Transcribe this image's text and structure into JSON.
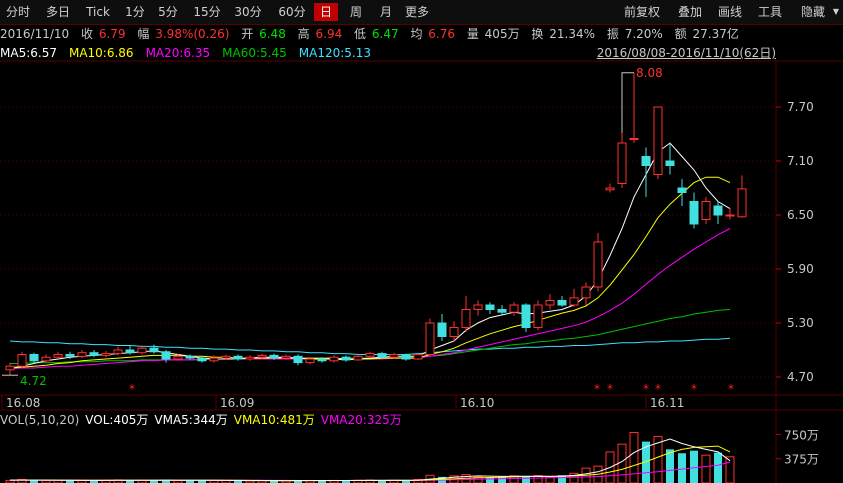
{
  "toolbar": {
    "periods": [
      "分时",
      "多日",
      "Tick",
      "1分",
      "5分",
      "15分",
      "30分",
      "60分",
      "日",
      "周",
      "月",
      "更多"
    ],
    "active_period": "日",
    "tools": [
      "前复权",
      "叠加",
      "画线",
      "工具",
      "隐藏"
    ]
  },
  "info": {
    "date": "2016/11/10",
    "close_label": "收",
    "close": "6.79",
    "change_label": "幅",
    "change": "3.98%(0.26)",
    "open_label": "开",
    "open": "6.48",
    "high_label": "高",
    "high": "6.94",
    "low_label": "低",
    "low": "6.47",
    "avg_label": "均",
    "avg": "6.76",
    "volume_label": "量",
    "volume": "405万",
    "turnover_label": "换",
    "turnover": "21.34%",
    "amplitude_label": "振",
    "amplitude": "7.20%",
    "amount_label": "额",
    "amount": "27.37亿"
  },
  "ma_legend": [
    {
      "text": "MA5:6.57",
      "color": "#ffffff"
    },
    {
      "text": "MA10:6.86",
      "color": "#ffff00"
    },
    {
      "text": "MA20:6.35",
      "color": "#ff00ff"
    },
    {
      "text": "MA60:5.45",
      "color": "#00c000"
    },
    {
      "text": "MA120:5.13",
      "color": "#40e0ff"
    }
  ],
  "range_label": "2016/08/08-2016/11/10(62日)",
  "price_axis": {
    "ticks": [
      "7.70",
      "7.10",
      "6.50",
      "5.90",
      "5.30",
      "4.70"
    ],
    "annotations": {
      "high": "8.08",
      "low": "4.72"
    }
  },
  "date_axis": [
    "16.08",
    "16.09",
    "16.10",
    "16.11"
  ],
  "volume_legend": [
    {
      "text": "VOL(5,10,20)",
      "color": "#c8c8c8"
    },
    {
      "text": "VOL:405万",
      "color": "#ffffff"
    },
    {
      "text": "VMA5:344万",
      "color": "#ffffff"
    },
    {
      "text": "VMA10:481万",
      "color": "#ffff00"
    },
    {
      "text": "VMA20:325万",
      "color": "#ff00ff"
    }
  ],
  "volume_axis": [
    "750万",
    "375万"
  ],
  "colors": {
    "up": "#ff3030",
    "down": "#40e0e0",
    "grid": "#5a0000",
    "ma5": "#ffffff",
    "ma10": "#ffff00",
    "ma20": "#ff00ff",
    "ma60": "#00c000",
    "ma120": "#40e0ff",
    "star": "#ff2020"
  },
  "chart_data": {
    "type": "candlestick",
    "title": "",
    "ylim": [
      4.5,
      8.2
    ],
    "candles": [
      {
        "o": 4.78,
        "c": 4.82,
        "h": 4.86,
        "l": 4.72
      },
      {
        "o": 4.82,
        "c": 4.95,
        "h": 4.98,
        "l": 4.8
      },
      {
        "o": 4.95,
        "c": 4.88,
        "h": 4.97,
        "l": 4.85
      },
      {
        "o": 4.88,
        "c": 4.92,
        "h": 4.95,
        "l": 4.86
      },
      {
        "o": 4.92,
        "c": 4.95,
        "h": 4.98,
        "l": 4.9
      },
      {
        "o": 4.95,
        "c": 4.93,
        "h": 4.98,
        "l": 4.9
      },
      {
        "o": 4.93,
        "c": 4.97,
        "h": 5.0,
        "l": 4.91
      },
      {
        "o": 4.97,
        "c": 4.94,
        "h": 5.0,
        "l": 4.92
      },
      {
        "o": 4.94,
        "c": 4.96,
        "h": 4.99,
        "l": 4.92
      },
      {
        "o": 4.96,
        "c": 5.0,
        "h": 5.04,
        "l": 4.94
      },
      {
        "o": 5.0,
        "c": 4.97,
        "h": 5.05,
        "l": 4.95
      },
      {
        "o": 4.97,
        "c": 5.02,
        "h": 5.05,
        "l": 4.95
      },
      {
        "o": 5.02,
        "c": 4.98,
        "h": 5.06,
        "l": 4.96
      },
      {
        "o": 4.98,
        "c": 4.9,
        "h": 5.0,
        "l": 4.86
      },
      {
        "o": 4.9,
        "c": 4.93,
        "h": 4.96,
        "l": 4.88
      },
      {
        "o": 4.93,
        "c": 4.91,
        "h": 4.95,
        "l": 4.89
      },
      {
        "o": 4.91,
        "c": 4.88,
        "h": 4.93,
        "l": 4.86
      },
      {
        "o": 4.88,
        "c": 4.91,
        "h": 4.94,
        "l": 4.86
      },
      {
        "o": 4.91,
        "c": 4.93,
        "h": 4.95,
        "l": 4.89
      },
      {
        "o": 4.93,
        "c": 4.9,
        "h": 4.95,
        "l": 4.88
      },
      {
        "o": 4.9,
        "c": 4.92,
        "h": 4.94,
        "l": 4.88
      },
      {
        "o": 4.92,
        "c": 4.94,
        "h": 4.96,
        "l": 4.9
      },
      {
        "o": 4.94,
        "c": 4.91,
        "h": 4.96,
        "l": 4.89
      },
      {
        "o": 4.91,
        "c": 4.93,
        "h": 4.95,
        "l": 4.89
      },
      {
        "o": 4.93,
        "c": 4.86,
        "h": 4.95,
        "l": 4.83
      },
      {
        "o": 4.86,
        "c": 4.9,
        "h": 4.92,
        "l": 4.84
      },
      {
        "o": 4.9,
        "c": 4.88,
        "h": 4.92,
        "l": 4.86
      },
      {
        "o": 4.88,
        "c": 4.92,
        "h": 4.94,
        "l": 4.86
      },
      {
        "o": 4.92,
        "c": 4.89,
        "h": 4.94,
        "l": 4.87
      },
      {
        "o": 4.89,
        "c": 4.93,
        "h": 4.96,
        "l": 4.88
      },
      {
        "o": 4.93,
        "c": 4.96,
        "h": 4.98,
        "l": 4.91
      },
      {
        "o": 4.96,
        "c": 4.92,
        "h": 4.98,
        "l": 4.9
      },
      {
        "o": 4.92,
        "c": 4.95,
        "h": 4.97,
        "l": 4.9
      },
      {
        "o": 4.95,
        "c": 4.9,
        "h": 4.96,
        "l": 4.88
      },
      {
        "o": 4.9,
        "c": 4.95,
        "h": 4.97,
        "l": 4.89
      },
      {
        "o": 4.95,
        "c": 5.3,
        "h": 5.35,
        "l": 4.94
      },
      {
        "o": 5.3,
        "c": 5.15,
        "h": 5.4,
        "l": 5.1
      },
      {
        "o": 5.15,
        "c": 5.25,
        "h": 5.32,
        "l": 5.1
      },
      {
        "o": 5.25,
        "c": 5.45,
        "h": 5.6,
        "l": 5.2
      },
      {
        "o": 5.45,
        "c": 5.5,
        "h": 5.55,
        "l": 5.38
      },
      {
        "o": 5.5,
        "c": 5.45,
        "h": 5.53,
        "l": 5.4
      },
      {
        "o": 5.45,
        "c": 5.42,
        "h": 5.5,
        "l": 5.38
      },
      {
        "o": 5.42,
        "c": 5.5,
        "h": 5.53,
        "l": 5.38
      },
      {
        "o": 5.5,
        "c": 5.25,
        "h": 5.52,
        "l": 5.2
      },
      {
        "o": 5.25,
        "c": 5.5,
        "h": 5.55,
        "l": 5.22
      },
      {
        "o": 5.5,
        "c": 5.55,
        "h": 5.62,
        "l": 5.45
      },
      {
        "o": 5.55,
        "c": 5.5,
        "h": 5.6,
        "l": 5.48
      },
      {
        "o": 5.5,
        "c": 5.58,
        "h": 5.68,
        "l": 5.48
      },
      {
        "o": 5.58,
        "c": 5.7,
        "h": 5.75,
        "l": 5.5
      },
      {
        "o": 5.7,
        "c": 6.2,
        "h": 6.3,
        "l": 5.65
      },
      {
        "o": 6.78,
        "c": 6.8,
        "h": 6.85,
        "l": 6.75
      },
      {
        "o": 6.85,
        "c": 7.3,
        "h": 7.45,
        "l": 6.8
      },
      {
        "o": 7.35,
        "c": 7.35,
        "h": 8.08,
        "l": 7.3
      },
      {
        "o": 7.15,
        "c": 7.05,
        "h": 7.25,
        "l": 6.7
      },
      {
        "o": 6.95,
        "c": 7.7,
        "h": 7.7,
        "l": 6.9
      },
      {
        "o": 7.1,
        "c": 7.05,
        "h": 7.3,
        "l": 6.95
      },
      {
        "o": 6.8,
        "c": 6.75,
        "h": 6.9,
        "l": 6.6
      },
      {
        "o": 6.65,
        "c": 6.4,
        "h": 6.75,
        "l": 6.35
      },
      {
        "o": 6.45,
        "c": 6.65,
        "h": 6.7,
        "l": 6.4
      },
      {
        "o": 6.6,
        "c": 6.5,
        "h": 6.65,
        "l": 6.4
      },
      {
        "o": 6.5,
        "c": 6.5,
        "h": 6.58,
        "l": 6.45
      },
      {
        "o": 6.48,
        "c": 6.79,
        "h": 6.94,
        "l": 6.47
      }
    ],
    "volumes": [
      40,
      55,
      45,
      38,
      42,
      35,
      40,
      38,
      44,
      48,
      40,
      42,
      45,
      50,
      38,
      36,
      35,
      40,
      38,
      36,
      34,
      36,
      35,
      34,
      45,
      38,
      36,
      40,
      38,
      42,
      45,
      40,
      42,
      40,
      55,
      120,
      95,
      110,
      130,
      90,
      85,
      95,
      110,
      105,
      115,
      90,
      120,
      150,
      230,
      260,
      480,
      600,
      780,
      640,
      720,
      520,
      460,
      500,
      430,
      470,
      405
    ],
    "vma5": [
      45,
      45,
      45,
      45,
      44,
      42,
      40,
      40,
      40,
      41,
      42,
      43,
      44,
      45,
      44,
      43,
      42,
      41,
      40,
      38,
      37,
      37,
      36,
      36,
      37,
      37,
      38,
      38,
      39,
      40,
      41,
      42,
      42,
      42,
      44,
      60,
      74,
      88,
      100,
      109,
      106,
      102,
      104,
      103,
      102,
      101,
      107,
      118,
      141,
      173,
      240,
      330,
      470,
      560,
      620,
      680,
      610,
      560,
      520,
      480,
      344
    ],
    "vma10": [
      45,
      45,
      45,
      45,
      45,
      44,
      43,
      42,
      42,
      42,
      42,
      42,
      42,
      42,
      42,
      42,
      42,
      42,
      42,
      41,
      40,
      39,
      38,
      37,
      37,
      37,
      37,
      37,
      38,
      38,
      39,
      39,
      40,
      40,
      41,
      48,
      56,
      64,
      72,
      80,
      85,
      90,
      95,
      100,
      104,
      103,
      105,
      110,
      120,
      135,
      170,
      210,
      270,
      330,
      400,
      470,
      520,
      550,
      560,
      570,
      481
    ],
    "vma20": [
      45,
      45,
      45,
      45,
      45,
      45,
      45,
      44,
      44,
      43,
      43,
      43,
      43,
      43,
      43,
      42,
      42,
      42,
      42,
      42,
      41,
      41,
      40,
      40,
      39,
      39,
      39,
      39,
      39,
      39,
      39,
      39,
      39,
      39,
      40,
      43,
      46,
      50,
      54,
      58,
      62,
      66,
      70,
      74,
      78,
      81,
      84,
      88,
      94,
      101,
      112,
      125,
      140,
      157,
      175,
      195,
      215,
      235,
      255,
      275,
      325
    ],
    "ma5": [
      4.8,
      4.82,
      4.85,
      4.88,
      4.9,
      4.92,
      4.93,
      4.94,
      4.95,
      4.96,
      4.97,
      4.98,
      4.99,
      4.97,
      4.95,
      4.93,
      4.91,
      4.9,
      4.9,
      4.9,
      4.91,
      4.92,
      4.92,
      4.92,
      4.91,
      4.9,
      4.9,
      4.9,
      4.89,
      4.9,
      4.91,
      4.92,
      4.93,
      4.93,
      4.93,
      5.0,
      5.05,
      5.1,
      5.22,
      5.3,
      5.36,
      5.39,
      5.42,
      5.4,
      5.41,
      5.43,
      5.45,
      5.5,
      5.6,
      5.78,
      6.05,
      6.35,
      6.7,
      6.95,
      7.2,
      7.3,
      7.15,
      7.0,
      6.8,
      6.65,
      6.57
    ],
    "ma10": [
      4.8,
      4.81,
      4.82,
      4.83,
      4.85,
      4.86,
      4.88,
      4.89,
      4.9,
      4.91,
      4.92,
      4.93,
      4.94,
      4.94,
      4.94,
      4.93,
      4.93,
      4.92,
      4.92,
      4.91,
      4.91,
      4.91,
      4.91,
      4.91,
      4.91,
      4.91,
      4.91,
      4.91,
      4.9,
      4.9,
      4.9,
      4.91,
      4.91,
      4.91,
      4.91,
      4.95,
      4.98,
      5.02,
      5.08,
      5.13,
      5.18,
      5.22,
      5.26,
      5.29,
      5.33,
      5.37,
      5.41,
      5.44,
      5.49,
      5.58,
      5.72,
      5.89,
      6.06,
      6.26,
      6.47,
      6.62,
      6.74,
      6.86,
      6.92,
      6.92,
      6.86
    ],
    "ma20": [
      4.79,
      4.8,
      4.8,
      4.81,
      4.82,
      4.82,
      4.83,
      4.84,
      4.85,
      4.86,
      4.87,
      4.88,
      4.88,
      4.89,
      4.89,
      4.89,
      4.9,
      4.9,
      4.9,
      4.9,
      4.9,
      4.9,
      4.9,
      4.9,
      4.9,
      4.9,
      4.9,
      4.9,
      4.9,
      4.9,
      4.9,
      4.9,
      4.91,
      4.91,
      4.91,
      4.93,
      4.95,
      4.97,
      5.0,
      5.03,
      5.06,
      5.09,
      5.12,
      5.15,
      5.18,
      5.21,
      5.24,
      5.27,
      5.31,
      5.37,
      5.44,
      5.52,
      5.62,
      5.73,
      5.84,
      5.94,
      6.03,
      6.12,
      6.2,
      6.28,
      6.35
    ],
    "ma60": [
      4.85,
      4.85,
      4.86,
      4.86,
      4.86,
      4.87,
      4.87,
      4.87,
      4.88,
      4.88,
      4.88,
      4.89,
      4.89,
      4.89,
      4.89,
      4.89,
      4.89,
      4.9,
      4.9,
      4.9,
      4.9,
      4.9,
      4.9,
      4.9,
      4.9,
      4.9,
      4.9,
      4.9,
      4.91,
      4.91,
      4.91,
      4.91,
      4.91,
      4.92,
      4.92,
      4.93,
      4.94,
      4.96,
      4.98,
      5.0,
      5.02,
      5.04,
      5.06,
      5.07,
      5.09,
      5.1,
      5.12,
      5.13,
      5.15,
      5.17,
      5.2,
      5.23,
      5.26,
      5.29,
      5.32,
      5.35,
      5.37,
      5.4,
      5.42,
      5.44,
      5.45
    ],
    "ma120": [
      5.1,
      5.09,
      5.09,
      5.08,
      5.08,
      5.07,
      5.07,
      5.06,
      5.06,
      5.05,
      5.05,
      5.04,
      5.04,
      5.03,
      5.03,
      5.02,
      5.02,
      5.01,
      5.01,
      5.0,
      5.0,
      4.99,
      4.99,
      4.98,
      4.98,
      4.97,
      4.97,
      4.96,
      4.96,
      4.95,
      4.95,
      4.95,
      4.95,
      4.95,
      4.96,
      4.97,
      4.98,
      4.99,
      5.0,
      5.01,
      5.01,
      5.02,
      5.02,
      5.03,
      5.03,
      5.04,
      5.04,
      5.05,
      5.05,
      5.06,
      5.07,
      5.08,
      5.08,
      5.09,
      5.09,
      5.1,
      5.1,
      5.11,
      5.12,
      5.12,
      5.13
    ],
    "star_indices": [
      16,
      58,
      59,
      60,
      61,
      62,
      63
    ]
  }
}
